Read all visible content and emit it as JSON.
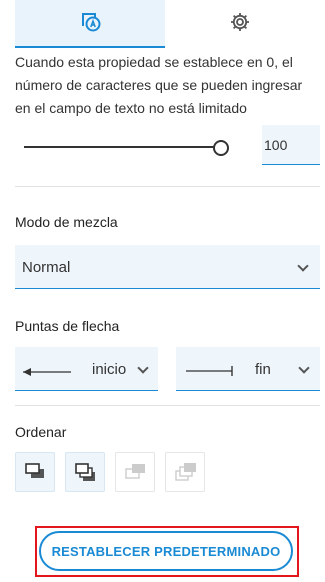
{
  "tabs": [
    {
      "icon": "text-style-icon",
      "active": true
    },
    {
      "icon": "gear-icon",
      "active": false
    }
  ],
  "description": "Cuando esta propiedad se establece en 0, el número de caracteres que se pueden ingresar en el campo de texto no está limitado",
  "max_chars": {
    "value": "100",
    "slider_level": 1.0
  },
  "blend_mode": {
    "label": "Modo de mezcla",
    "value": "Normal"
  },
  "arrowheads": {
    "label": "Puntas de flecha",
    "start": "inicio",
    "end": "fin"
  },
  "order": {
    "label": "Ordenar",
    "buttons": [
      "bring-to-front-icon",
      "bring-forward-icon",
      "send-backward-icon",
      "send-to-back-icon"
    ]
  },
  "reset_button": "RESTABLECER PREDETERMINADO",
  "colors": {
    "accent": "#1a8ad4",
    "field_bg": "#eef5fb",
    "highlight": "#e3161b"
  }
}
